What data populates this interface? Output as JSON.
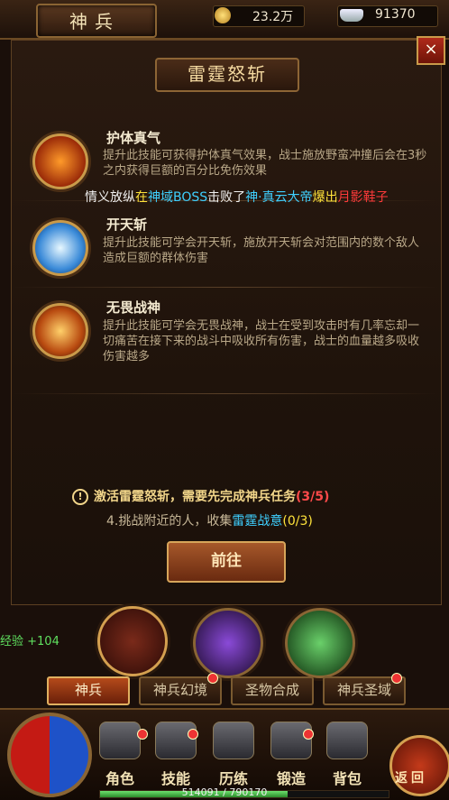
{
  "header": {
    "title": "神兵",
    "coins": "23.2万",
    "ingots": "91370"
  },
  "panel": {
    "close_label": "×",
    "skill_title": "雷霆怒斩"
  },
  "skills": [
    {
      "name": "护体真气",
      "desc": "提升此技能可获得护体真气效果，战士施放野蛮冲撞后会在3秒之内获得巨额的百分比免伤效果",
      "icon": "running-man-fire-icon"
    },
    {
      "name": "开天斩",
      "desc": "提升此技能可学会开天斩，施放开天斩会对范围内的数个敌人造成巨额的群体伤害",
      "icon": "ice-blade-icon"
    },
    {
      "name": "无畏战神",
      "desc": "提升此技能可学会无畏战神，战士在受到攻击时有几率忘却一切痛苦在接下来的战斗中吸收所有伤害，战士的血量越多吸收伤害越多",
      "icon": "flame-warrior-icon"
    }
  ],
  "chat": {
    "p1": "情义放纵",
    "p2": "在",
    "p3": "神域BOSS",
    "p4": "击败了",
    "p5": "神·真云大帝",
    "p6": "爆出",
    "p7": "月影鞋子"
  },
  "quest": {
    "warn_icon": "!",
    "warn_prefix": "激活雷霆怒斩，需要先完成神兵任务",
    "warn_progress": "(3/5)",
    "task_prefix": "4.挑战附近的人，收集",
    "task_item": "雷霆战意",
    "task_progress": "(0/3)",
    "go_label": "前往"
  },
  "exp_gain": "经验 +104",
  "tabs": [
    "神兵",
    "神兵幻境",
    "圣物合成",
    "神兵圣域"
  ],
  "nav": [
    "角色",
    "技能",
    "历练",
    "锻造",
    "背包"
  ],
  "back_label": "返回",
  "exp": {
    "text": "514091 / 790170",
    "fraction": 0.65
  },
  "colors": {
    "cyan": "#3fd0ff",
    "yellow": "#ffe33a",
    "red": "#ff3a3a",
    "gold": "#f2d68a",
    "green": "#5fe05f"
  }
}
